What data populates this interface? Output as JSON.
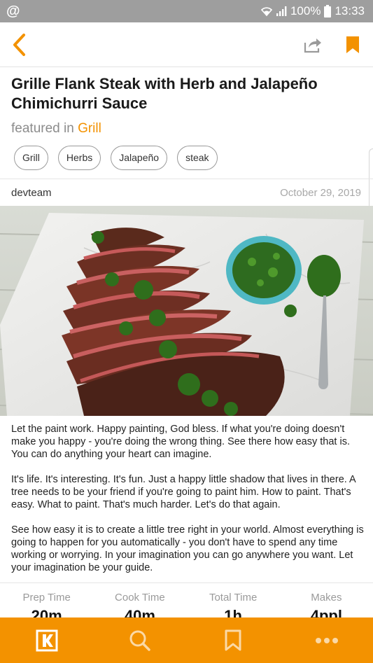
{
  "status_bar": {
    "at_symbol": "@",
    "battery_text": "100%",
    "time": "13:33"
  },
  "header": {
    "back_icon": "chevron-left-icon",
    "share_icon": "share-icon",
    "bookmark_icon": "bookmark-icon",
    "accent_color": "#f39200"
  },
  "article": {
    "title": "Grille Flank Steak with Herb and Jalapeño Chimichurri Sauce",
    "featured_prefix": "featured in",
    "featured_category": "Grill",
    "tags": [
      "Grill",
      "Herbs",
      "Jalapeño",
      "steak"
    ],
    "author": "devteam",
    "date": "October 29, 2019",
    "image_alt": "Sliced grilled flank steak with chimichurri sauce on a marble board",
    "paragraphs": [
      "Let the paint work. Happy painting, God bless. If what you're doing doesn't make you happy - you're doing the wrong thing. See there how easy that is. You can do anything your heart can imagine.",
      "It's life. It's interesting. It's fun. Just a happy little shadow that lives in there. A tree needs to be your friend if you're going to paint him. How to paint. That's easy. What to paint. That's much harder. Let's do that again.",
      "See how easy it is to create a little tree right in your world. Almost everything is going to happen for you automatically - you don't have to spend any time working or worrying. In your imagination you can go anywhere you want. Let your imagination be your guide."
    ]
  },
  "stats": [
    {
      "label": "Prep Time",
      "value": "20m"
    },
    {
      "label": "Cook Time",
      "value": "40m"
    },
    {
      "label": "Total Time",
      "value": "1h"
    },
    {
      "label": "Makes",
      "value": "4ppl"
    }
  ],
  "bottom_nav": {
    "items": [
      {
        "icon": "k-logo-icon"
      },
      {
        "icon": "search-icon"
      },
      {
        "icon": "bookmark-outline-icon"
      },
      {
        "icon": "more-icon"
      }
    ],
    "background": "#f39200"
  }
}
